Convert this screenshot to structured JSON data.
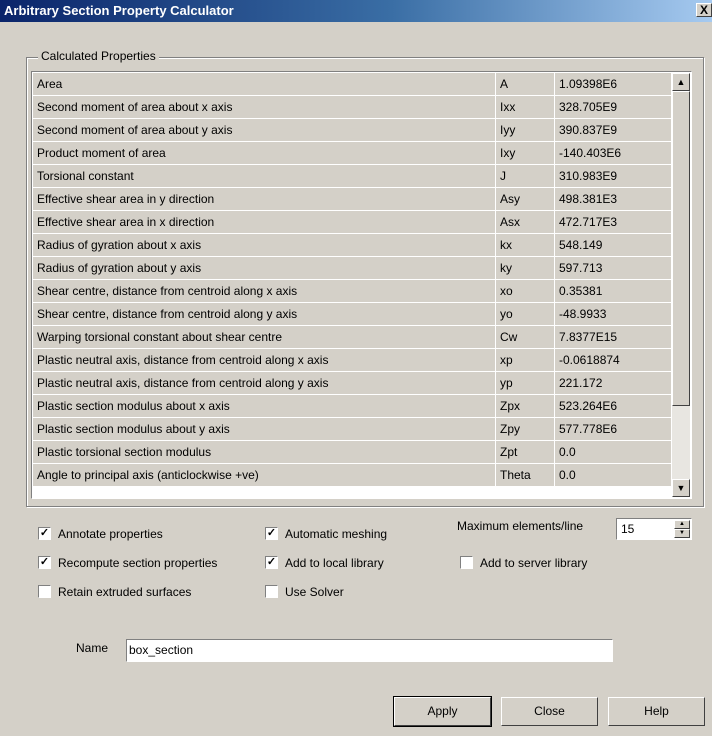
{
  "window": {
    "title": "Arbitrary Section Property Calculator",
    "close_glyph": "X"
  },
  "group_label": "Calculated Properties",
  "properties": [
    {
      "name": "Area",
      "symbol": "A",
      "value": "1.09398E6"
    },
    {
      "name": "Second moment of area about x axis",
      "symbol": "Ixx",
      "value": "328.705E9"
    },
    {
      "name": "Second moment of area about y axis",
      "symbol": "Iyy",
      "value": "390.837E9"
    },
    {
      "name": "Product moment of area",
      "symbol": "Ixy",
      "value": "-140.403E6"
    },
    {
      "name": "Torsional constant",
      "symbol": "J",
      "value": "310.983E9"
    },
    {
      "name": "Effective shear area in y direction",
      "symbol": "Asy",
      "value": "498.381E3"
    },
    {
      "name": "Effective shear area in x direction",
      "symbol": "Asx",
      "value": "472.717E3"
    },
    {
      "name": "Radius of gyration about x axis",
      "symbol": "kx",
      "value": "548.149"
    },
    {
      "name": "Radius of gyration about y axis",
      "symbol": "ky",
      "value": "597.713"
    },
    {
      "name": "Shear centre, distance from centroid along  x axis",
      "symbol": "xo",
      "value": "0.35381"
    },
    {
      "name": "Shear centre, distance from centroid along  y axis",
      "symbol": "yo",
      "value": "-48.9933"
    },
    {
      "name": "Warping torsional constant about shear centre",
      "symbol": "Cw",
      "value": "7.8377E15"
    },
    {
      "name": "Plastic neutral axis, distance from centroid along x axis",
      "symbol": "xp",
      "value": "-0.0618874"
    },
    {
      "name": "Plastic neutral axis, distance from centroid along y axis",
      "symbol": "yp",
      "value": "221.172"
    },
    {
      "name": "Plastic section modulus about x axis",
      "symbol": "Zpx",
      "value": "523.264E6"
    },
    {
      "name": "Plastic section modulus about y axis",
      "symbol": "Zpy",
      "value": "577.778E6"
    },
    {
      "name": "Plastic torsional section modulus",
      "symbol": "Zpt",
      "value": "0.0"
    },
    {
      "name": "Angle to principal axis (anticlockwise +ve)",
      "symbol": "Theta",
      "value": "0.0"
    }
  ],
  "scrollbar": {
    "up_glyph": "▲",
    "down_glyph": "▼"
  },
  "options": {
    "annotate": {
      "label": "Annotate properties",
      "checked": true
    },
    "recompute": {
      "label": "Recompute section properties",
      "checked": true
    },
    "retain": {
      "label": "Retain extruded surfaces",
      "checked": false
    },
    "auto_mesh": {
      "label": "Automatic meshing",
      "checked": true
    },
    "add_local": {
      "label": "Add to local library",
      "checked": true
    },
    "use_solver": {
      "label": "Use Solver",
      "checked": false
    },
    "add_server": {
      "label": "Add to server library",
      "checked": false
    }
  },
  "max_elements": {
    "label": "Maximum elements/line",
    "value": "15"
  },
  "name_field": {
    "label": "Name",
    "value": "box_section"
  },
  "buttons": {
    "apply": "Apply",
    "close": "Close",
    "help": "Help"
  }
}
